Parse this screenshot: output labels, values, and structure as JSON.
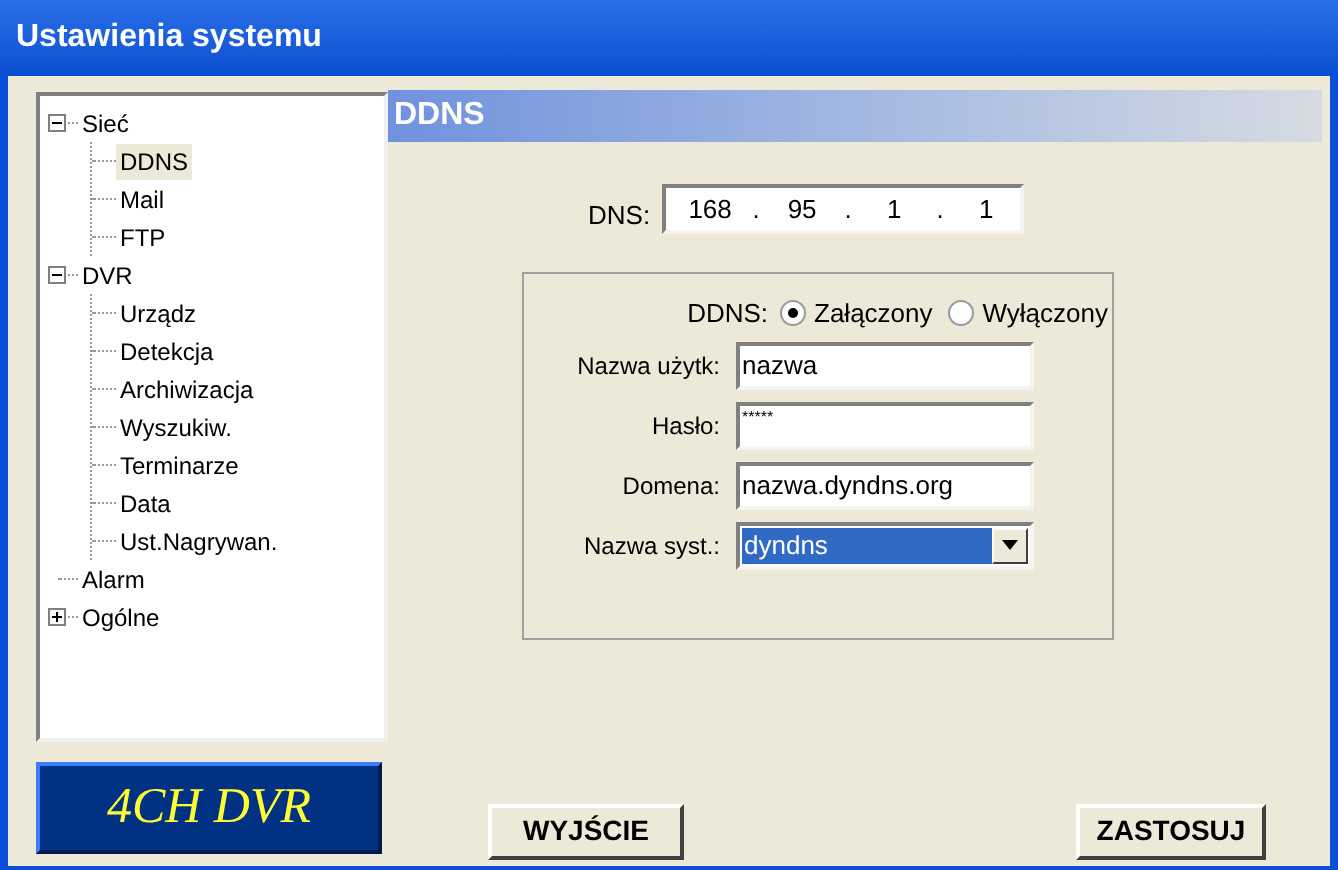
{
  "window": {
    "title": "Ustawienia systemu"
  },
  "tree": [
    {
      "label": "Sieć",
      "expanded": true,
      "selected": false,
      "children": [
        {
          "label": "DDNS",
          "selected": true
        },
        {
          "label": "Mail",
          "selected": false
        },
        {
          "label": "FTP",
          "selected": false
        }
      ]
    },
    {
      "label": "DVR",
      "expanded": true,
      "selected": false,
      "children": [
        {
          "label": "Urządz",
          "selected": false
        },
        {
          "label": "Detekcja",
          "selected": false
        },
        {
          "label": "Archiwizacja",
          "selected": false
        },
        {
          "label": "Wyszukiw.",
          "selected": false
        },
        {
          "label": "Terminarze",
          "selected": false
        },
        {
          "label": "Data",
          "selected": false
        },
        {
          "label": "Ust.Nagrywan.",
          "selected": false
        }
      ]
    },
    {
      "label": "Alarm",
      "selected": false
    },
    {
      "label": "Ogólne",
      "expanded": false,
      "selected": false
    }
  ],
  "logo": "4CH DVR",
  "panel": {
    "title": "DDNS",
    "dns": {
      "label": "DNS:",
      "octets": [
        "168",
        "95",
        "1",
        "1"
      ],
      "separator": "."
    },
    "ddns": {
      "label": "DDNS:",
      "options": [
        {
          "label": "Załączony",
          "selected": true
        },
        {
          "label": "Wyłączony",
          "selected": false
        }
      ]
    },
    "fields": [
      {
        "kind": "text",
        "label": "Nazwa użytk:",
        "value": "nazwa"
      },
      {
        "kind": "password",
        "label": "Hasło:",
        "value": "*****"
      },
      {
        "kind": "text",
        "label": "Domena:",
        "value": "nazwa.dyndns.org"
      },
      {
        "kind": "select",
        "label": "Nazwa syst.:",
        "value": "dyndns",
        "focused": true
      }
    ]
  },
  "buttons": {
    "exit": "WYJŚCIE",
    "apply": "ZASTOSUJ"
  }
}
